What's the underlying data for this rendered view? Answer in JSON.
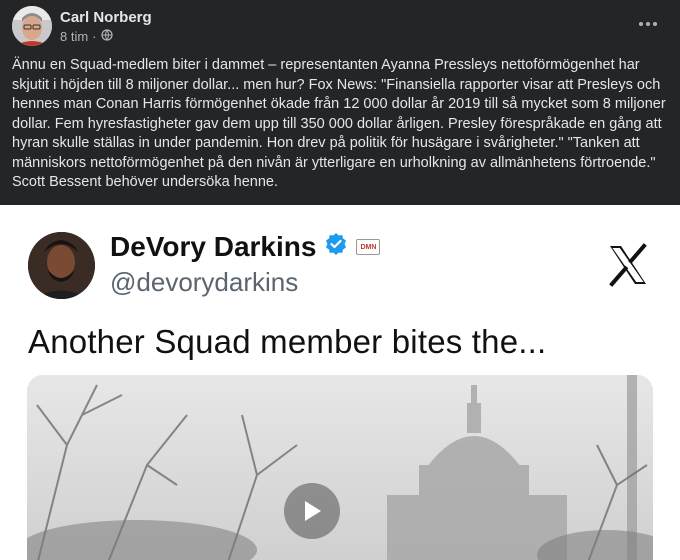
{
  "post": {
    "author": "Carl Norberg",
    "time": "8 tim",
    "separator": "·",
    "body": "Ännu en Squad-medlem biter i dammet – representanten Ayanna Pressleys nettoförmögenhet har skjutit i höjden till 8 miljoner dollar... men hur? Fox News: \"Finansiella rapporter visar att Presleys och hennes man Conan Harris förmögenhet ökade från 12 000 dollar år 2019 till så mycket som 8 miljoner dollar. Fem hyresfastigheter gav dem upp till 350 000 dollar årligen. Presley förespråkade en gång att hyran skulle ställas in under pandemin. Hon drev på politik för husägare i svårigheter.\" \"Tanken att människors nettoförmögenhet på den nivån är ytterligare en urholkning av allmänhetens förtroende.\" Scott Bessent behöver undersöka henne."
  },
  "media": {
    "name": "DeVory Darkins",
    "handle": "@devorydarkins",
    "badge_text": "DMN",
    "tweet_text": "Another Squad member bites the..."
  },
  "colors": {
    "background": "#242526",
    "text": "#e4e6eb",
    "muted": "#b0b3b8",
    "verified": "#1d9bf0"
  },
  "icons": {
    "privacy": "globe-icon",
    "more": "more-options-icon",
    "verified": "verified-badge-icon",
    "platform": "x-logo-icon",
    "play": "play-icon"
  }
}
